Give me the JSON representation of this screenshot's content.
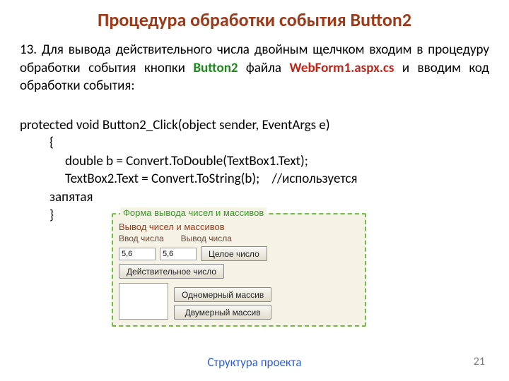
{
  "title": "Процедура обработки события Button2",
  "para": {
    "num": "13.",
    "t1": " Для вывода действительного числа двойным щелчком входим в процедуру обработки события кнопки ",
    "btn": "Button2",
    "t2": " файла ",
    "file": "WebForm1.aspx.cs",
    "t3": " и вводим код обработки события:"
  },
  "code": {
    "l1": "protected void Button2_Click(object sender, EventArgs e)",
    "l2": "{",
    "l3": "double b = Convert.ToDouble(TextBox1.Text);",
    "l4": "TextBox2.Text = Convert.ToString(b);    //используется",
    "l5": "запятая",
    "l6": "}"
  },
  "form": {
    "legend": "Форма вывода чисел и массивов",
    "section_title": "Вывод чисел и массивов",
    "lbl_input": "Ввод числа",
    "lbl_output": "Вывод числа",
    "val_in": "5,6",
    "val_out": "5,6",
    "btn_int": "Целое число",
    "btn_double": "Действительное число",
    "btn_arr1": "Одномерный массив",
    "btn_arr2": "Двумерный массив"
  },
  "footer": "Структура проекта",
  "page": "21"
}
